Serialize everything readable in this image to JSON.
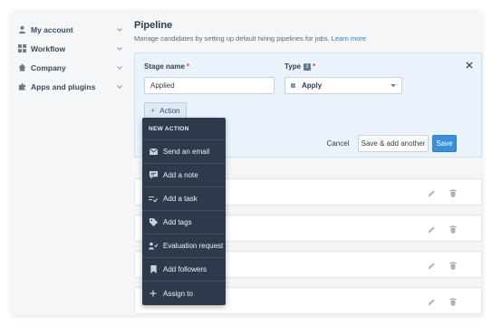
{
  "sidebar": {
    "items": [
      {
        "label": "My account",
        "icon": "user-icon"
      },
      {
        "label": "Workflow",
        "icon": "grid-icon"
      },
      {
        "label": "Company",
        "icon": "home-icon"
      },
      {
        "label": "Apps and plugins",
        "icon": "puzzle-icon"
      }
    ]
  },
  "header": {
    "title": "Pipeline",
    "subtitle": "Manage candidates by setting up default hiring pipelines for jobs.",
    "learn_more": "Learn more"
  },
  "form": {
    "stage_label": "Stage name",
    "stage_value": "Applied",
    "type_label": "Type",
    "type_value": "Apply",
    "required_mark": "*",
    "info_mark": "i",
    "action_label": "Action",
    "action_plus": "+",
    "cancel_label": "Cancel",
    "save_add_label": "Save & add another",
    "save_label": "Save"
  },
  "menu": {
    "heading": "NEW ACTION",
    "items": [
      {
        "label": "Send an email",
        "icon": "mail-icon"
      },
      {
        "label": "Add a note",
        "icon": "note-icon"
      },
      {
        "label": "Add a task",
        "icon": "task-icon"
      },
      {
        "label": "Add tags",
        "icon": "tag-icon"
      },
      {
        "label": "Evaluation request",
        "icon": "evaluation-icon"
      },
      {
        "label": "Add followers",
        "icon": "bookmark-icon"
      },
      {
        "label": "Assign to",
        "icon": "plus-icon"
      }
    ]
  },
  "colors": {
    "primary": "#3b8fd9",
    "menu_bg": "#2c3a4b",
    "required": "#e0413a"
  }
}
